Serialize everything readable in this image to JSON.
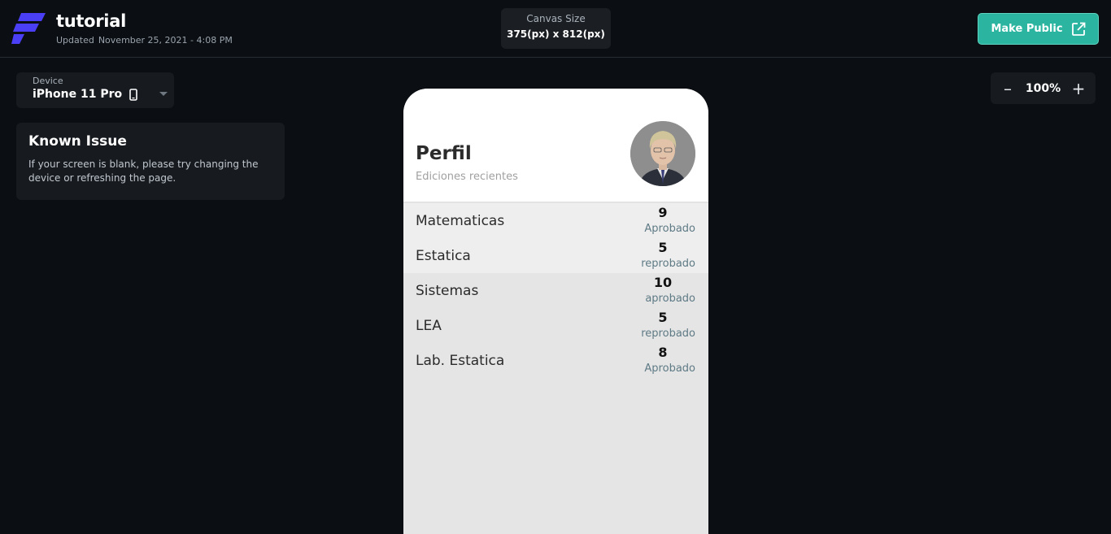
{
  "header": {
    "app_title": "tutorial",
    "updated_label": "Updated",
    "updated_value": "November 25, 2021 - 4:08 PM",
    "canvas_size_label": "Canvas Size",
    "canvas_size_value": "375(px) x 812(px)",
    "make_public_label": "Make Public",
    "logo_icon": "flutterflow-logo-icon",
    "external_link_icon": "external-link-icon"
  },
  "device": {
    "label": "Device",
    "value": "iPhone 11 Pro",
    "icon": "phone-icon"
  },
  "known_issue": {
    "title": "Known Issue",
    "message": "If your screen is blank, please try changing the device or refreshing the page."
  },
  "zoom": {
    "minus": "–",
    "value": "100%",
    "plus": "+"
  },
  "preview": {
    "title": "Perfil",
    "subtitle": "Ediciones recientes",
    "rows": [
      {
        "subject": "Matematicas",
        "grade": "9",
        "status": "Aprobado"
      },
      {
        "subject": "Estatica",
        "grade": "5",
        "status": "reprobado"
      },
      {
        "subject": "Sistemas",
        "grade": "10",
        "status": "aprobado"
      },
      {
        "subject": "LEA",
        "grade": "5",
        "status": "reprobado"
      },
      {
        "subject": "Lab. Estatica",
        "grade": "8",
        "status": "Aprobado"
      }
    ]
  },
  "colors": {
    "background": "#0b0f13",
    "panel": "#171b20",
    "accent": "#2bb5a0",
    "logo": "#4b3ff5",
    "status_text": "#5e7a85"
  }
}
